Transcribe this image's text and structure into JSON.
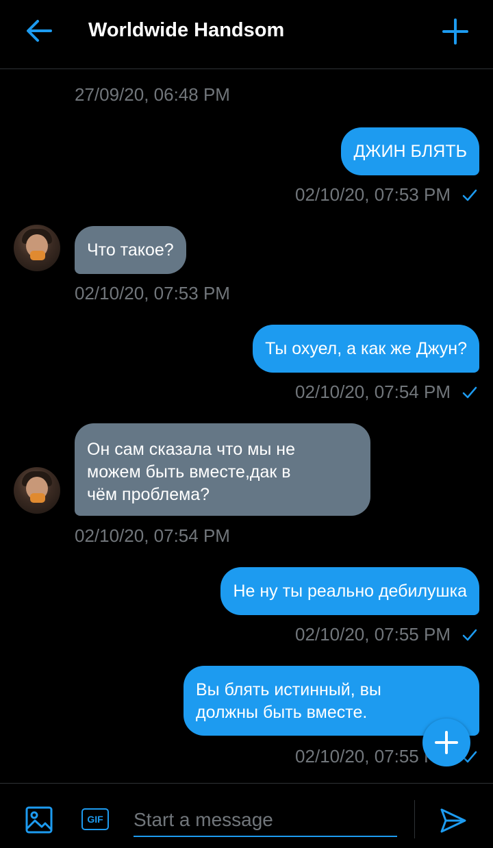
{
  "header": {
    "title": "Worldwide Handsom"
  },
  "messages": [
    {
      "direction": "out",
      "text": "ДЖИН БЛЯТЬ",
      "timestamp": "02/10/20, 07:53 PM",
      "status": "sent"
    },
    {
      "direction": "in",
      "text": "Что такое?",
      "timestamp": "02/10/20, 07:53 PM"
    },
    {
      "direction": "out",
      "text": "Ты охуел, а как же Джун?",
      "timestamp": "02/10/20, 07:54 PM",
      "status": "sent"
    },
    {
      "direction": "in",
      "lines": [
        "Он сам сказала что мы не",
        "можем быть вместе,дак в",
        "чём проблема?"
      ],
      "timestamp": "02/10/20, 07:54 PM"
    },
    {
      "direction": "out",
      "text": "Не ну ты реально дебилушка",
      "timestamp": "02/10/20, 07:55 PM",
      "status": "sent"
    },
    {
      "direction": "out",
      "lines": [
        "Вы блять истинный, вы",
        "должны быть вместе."
      ],
      "timestamp": "02/10/20, 07:55 PM",
      "status": "sent"
    }
  ],
  "top_timestamp": "27/09/20, 06:48 PM",
  "composer": {
    "placeholder": "Start a message",
    "gif_label": "GIF"
  },
  "icons": {
    "back": "arrow-left-icon",
    "add": "plus-icon",
    "media": "image-icon",
    "gif": "gif-icon",
    "send": "send-icon",
    "check": "check-icon"
  },
  "colors": {
    "accent": "#1d9bf0",
    "incoming_bubble": "#657786",
    "timestamp": "#71767b",
    "background": "#000000"
  }
}
